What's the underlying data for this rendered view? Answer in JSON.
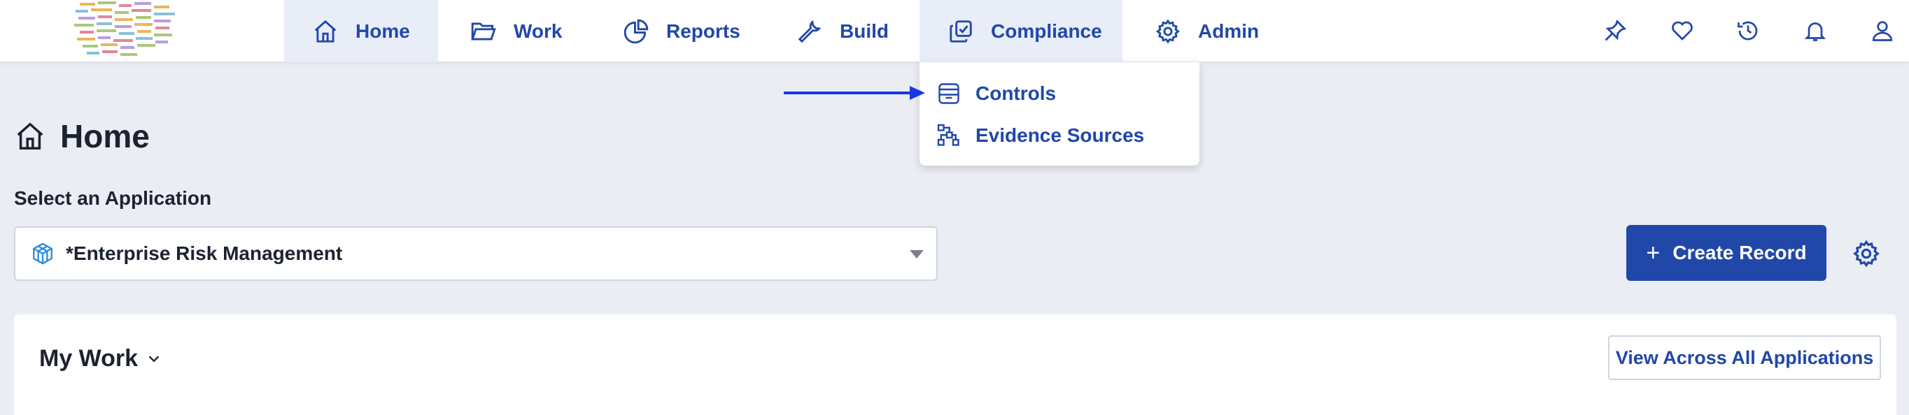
{
  "nav": {
    "items": [
      {
        "label": "Home",
        "icon": "home-icon"
      },
      {
        "label": "Work",
        "icon": "folder-icon"
      },
      {
        "label": "Reports",
        "icon": "pie-chart-icon"
      },
      {
        "label": "Build",
        "icon": "wrench-icon"
      },
      {
        "label": "Compliance",
        "icon": "compliance-icon"
      },
      {
        "label": "Admin",
        "icon": "gear-icon"
      }
    ],
    "right_icons": [
      "pin-icon",
      "heart-icon",
      "history-icon",
      "bell-icon",
      "user-icon"
    ]
  },
  "compliance_menu": {
    "items": [
      {
        "label": "Controls",
        "icon": "archive-box-icon"
      },
      {
        "label": "Evidence Sources",
        "icon": "evidence-sources-icon"
      }
    ]
  },
  "page": {
    "title": "Home",
    "select_label": "Select an Application",
    "selected_application": "*Enterprise Risk Management",
    "create_button": "Create Record"
  },
  "my_work": {
    "title": "My Work",
    "view_all_button": "View Across All Applications"
  },
  "colors": {
    "accent": "#2147a8",
    "background": "#eaedf3",
    "active_nav_bg": "#e8edf8",
    "annotation_arrow": "#1a35e8"
  }
}
